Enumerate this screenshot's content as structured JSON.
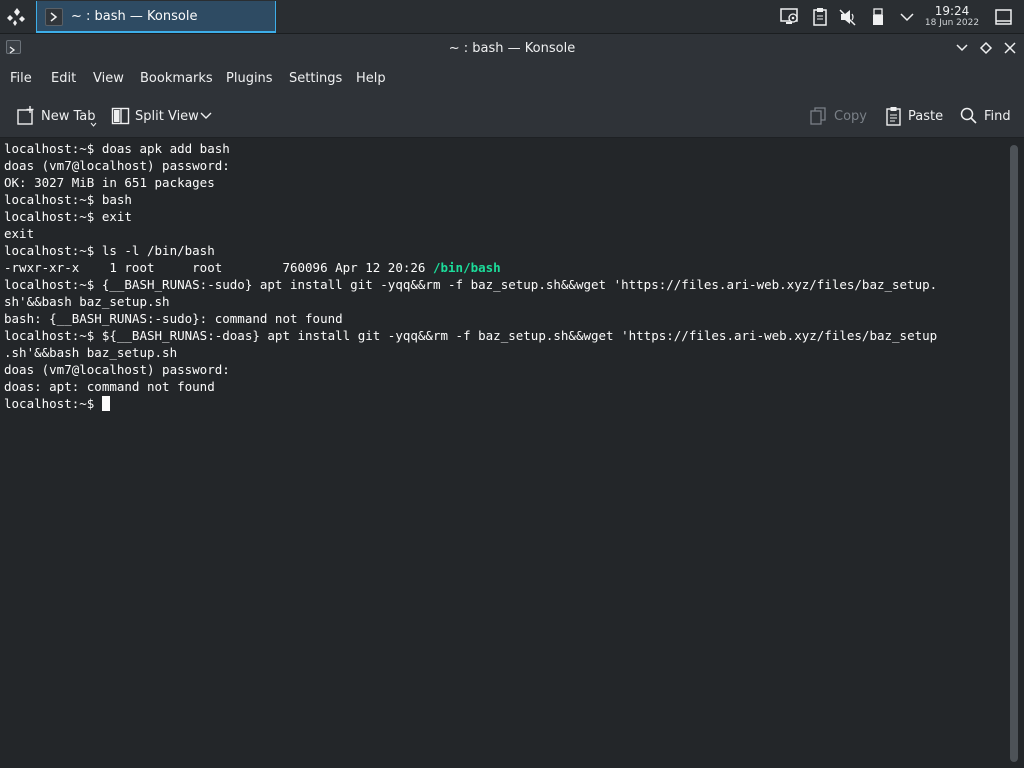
{
  "taskbar": {
    "task_title": "~ : bash — Konsole",
    "clock_time": "19:24",
    "clock_date": "18 Jun 2022"
  },
  "window": {
    "title": "~ : bash — Konsole"
  },
  "menu": {
    "file": "File",
    "edit": "Edit",
    "view": "View",
    "bookmarks": "Bookmarks",
    "plugins": "Plugins",
    "settings": "Settings",
    "help": "Help"
  },
  "toolbar": {
    "new_tab": "New Tab",
    "split_view": "Split View",
    "copy": "Copy",
    "paste": "Paste",
    "find": "Find"
  },
  "terminal": {
    "lines": [
      "localhost:~$ doas apk add bash",
      "doas (vm7@localhost) password:",
      "OK: 3027 MiB in 651 packages",
      "localhost:~$ bash",
      "localhost:~$ exit",
      "exit",
      "localhost:~$ ls -l /bin/bash",
      "-rwxr-xr-x    1 root     root        760096 Apr 12 20:26 ",
      "localhost:~$ {__BASH_RUNAS:-sudo} apt install git -yqq&&rm -f baz_setup.sh&&wget 'https://files.ari-web.xyz/files/baz_setup.",
      "sh'&&bash baz_setup.sh",
      "bash: {__BASH_RUNAS:-sudo}: command not found",
      "localhost:~$ ${__BASH_RUNAS:-doas} apt install git -yqq&&rm -f baz_setup.sh&&wget 'https://files.ari-web.xyz/files/baz_setup",
      ".sh'&&bash baz_setup.sh",
      "doas (vm7@localhost) password:",
      "doas: apt: command not found",
      "localhost:~$ "
    ],
    "ls_path": "/bin/bash",
    "exe_color": "#1cdc9a"
  },
  "icons": {
    "launcher": "application-launcher-icon",
    "tray": [
      "display-config-icon",
      "clipboard-icon",
      "audio-muted-icon",
      "usb-device-icon",
      "tray-expand-chevron-icon",
      "show-desktop-icon"
    ]
  }
}
